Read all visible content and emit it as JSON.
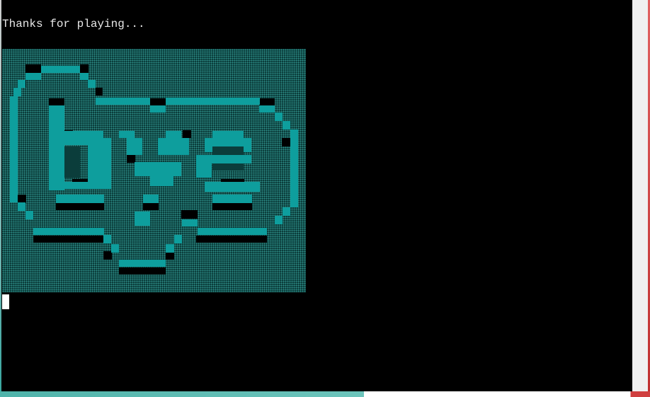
{
  "console": {
    "message": "Thanks for playing...",
    "ascii_art_icon": "bye-banner-icon",
    "cursor_icon": "block-cursor-icon"
  },
  "colors": {
    "background": "#000000",
    "text": "#e8e8e8",
    "art_teal": "#0e9e9d",
    "art_shadow": "#000000",
    "cursor": "#ffffff"
  }
}
